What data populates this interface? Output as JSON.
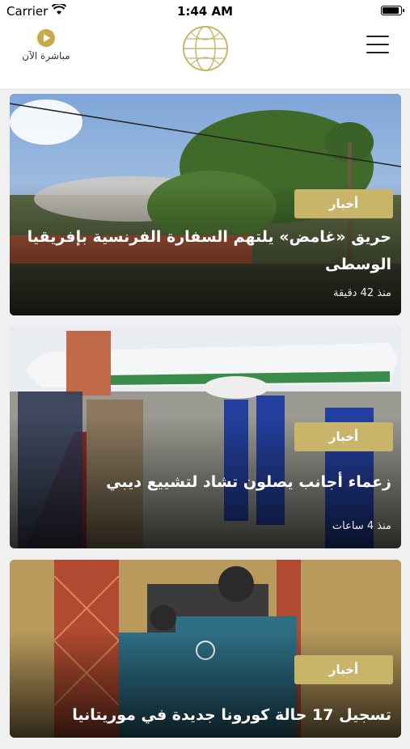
{
  "status_bar": {
    "carrier": "Carrier",
    "time": "1:44 AM"
  },
  "header": {
    "live_label": "مباشرة الآن",
    "logo_icon": "globe-logo-icon",
    "menu_icon": "hamburger-menu-icon"
  },
  "colors": {
    "accent": "#c9b56a",
    "live": "#c9a94c"
  },
  "articles": [
    {
      "category": "أخبار",
      "title": "حريق «غامض» يلتهم السفارة الفرنسية بإفريقيا الوسطى",
      "time_ago": "منذ 42 دقيقة"
    },
    {
      "category": "أخبار",
      "title": "زعماء أجانب يصلون تشاد لتشييع ديبي",
      "time_ago": "منذ 4 ساعات"
    },
    {
      "category": "أخبار",
      "title": "تسجيل 17 حالة كورونا جديدة في موريتانيا",
      "time_ago": ""
    }
  ]
}
